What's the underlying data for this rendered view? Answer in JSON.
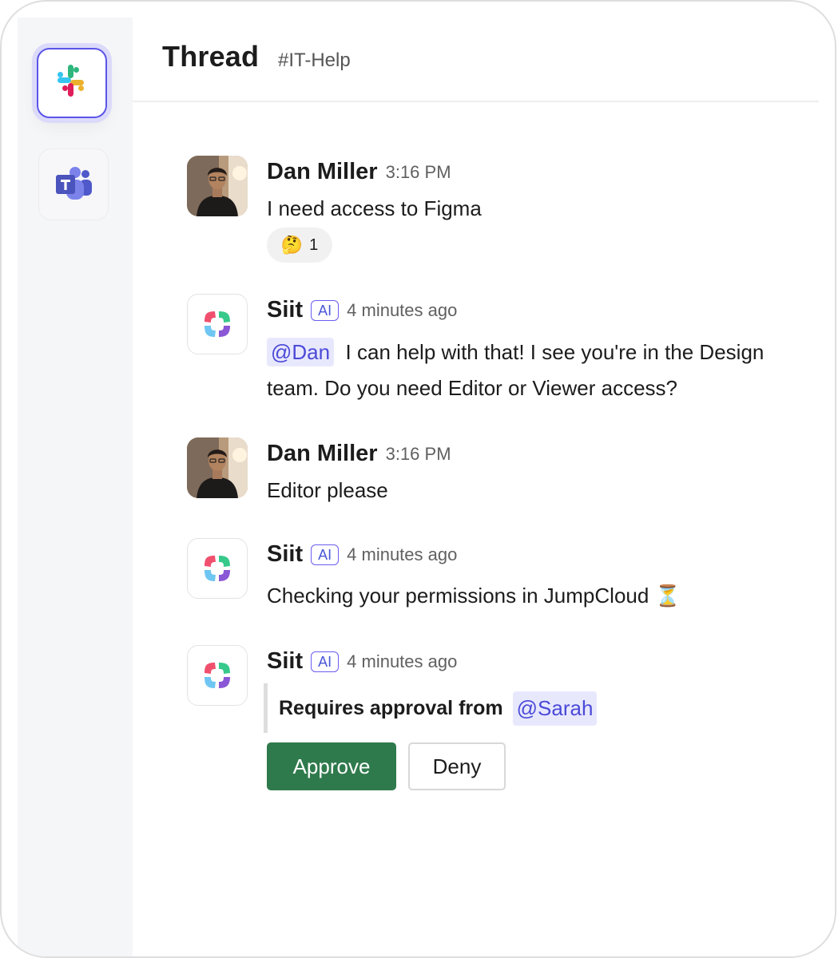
{
  "header": {
    "title": "Thread",
    "channel": "#IT-Help"
  },
  "apps": [
    {
      "name": "Slack",
      "icon": "slack-icon",
      "selected": true
    },
    {
      "name": "Microsoft Teams",
      "icon": "teams-icon",
      "selected": false
    }
  ],
  "messages": [
    {
      "author": "Dan Miller",
      "time": "3:16 PM",
      "text": "I need access to Figma",
      "reaction": {
        "emoji": "🤔",
        "count": "1"
      }
    },
    {
      "author": "Siit",
      "badge": "AI",
      "time": "4 minutes ago",
      "mention": "@Dan",
      "text": "I can help with that! I see you're in the Design team. Do you need Editor or Viewer access?"
    },
    {
      "author": "Dan Miller",
      "time": "3:16 PM",
      "text": "Editor please"
    },
    {
      "author": "Siit",
      "badge": "AI",
      "time": "4 minutes ago",
      "text": "Checking your permissions in JumpCloud ⏳"
    },
    {
      "author": "Siit",
      "badge": "AI",
      "time": "4 minutes ago",
      "quote": {
        "label": "Requires approval from",
        "mention": "@Sarah"
      },
      "actions": {
        "approve": "Approve",
        "deny": "Deny"
      }
    }
  ],
  "colors": {
    "accent": "#5b54e8",
    "mention_bg": "#e8e8fd",
    "mention_text": "#4b4ad8",
    "approve": "#2f7a4c"
  }
}
